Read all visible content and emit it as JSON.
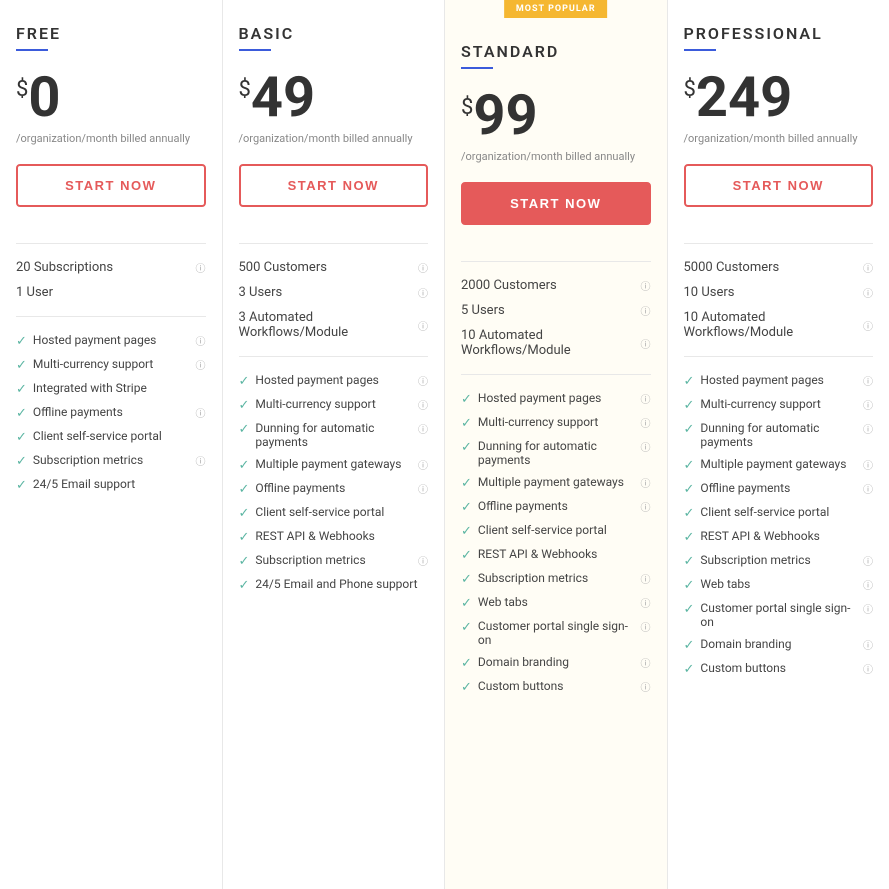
{
  "plans": [
    {
      "id": "free",
      "name": "FREE",
      "highlighted": false,
      "mostPopular": false,
      "price": "0",
      "period": "/organization/month billed annually",
      "cta": "START NOW",
      "ctaPrimary": false,
      "stats": [
        {
          "text": "20 Subscriptions",
          "hasInfo": true
        },
        {
          "text": "1 User",
          "hasInfo": false
        }
      ],
      "features": [
        {
          "text": "Hosted payment pages",
          "hasInfo": true
        },
        {
          "text": "Multi-currency support",
          "hasInfo": true
        },
        {
          "text": "Integrated with Stripe",
          "hasInfo": false
        },
        {
          "text": "Offline payments",
          "hasInfo": true
        },
        {
          "text": "Client self-service portal",
          "hasInfo": false
        },
        {
          "text": "Subscription metrics",
          "hasInfo": true
        },
        {
          "text": "24/5 Email support",
          "hasInfo": false
        }
      ]
    },
    {
      "id": "basic",
      "name": "BASIC",
      "highlighted": false,
      "mostPopular": false,
      "price": "49",
      "period": "/organization/month billed annually",
      "cta": "START NOW",
      "ctaPrimary": false,
      "stats": [
        {
          "text": "500 Customers",
          "hasInfo": true
        },
        {
          "text": "3 Users",
          "hasInfo": true
        },
        {
          "text": "3 Automated Workflows/Module",
          "hasInfo": true
        }
      ],
      "features": [
        {
          "text": "Hosted payment pages",
          "hasInfo": true
        },
        {
          "text": "Multi-currency support",
          "hasInfo": true
        },
        {
          "text": "Dunning for automatic payments",
          "hasInfo": true
        },
        {
          "text": "Multiple payment gateways",
          "hasInfo": true
        },
        {
          "text": "Offline payments",
          "hasInfo": true
        },
        {
          "text": "Client self-service portal",
          "hasInfo": false
        },
        {
          "text": "REST API & Webhooks",
          "hasInfo": false
        },
        {
          "text": "Subscription metrics",
          "hasInfo": true
        },
        {
          "text": "24/5 Email and Phone support",
          "hasInfo": false
        }
      ]
    },
    {
      "id": "standard",
      "name": "STANDARD",
      "highlighted": true,
      "mostPopular": true,
      "mostPopularLabel": "MOST POPULAR",
      "price": "99",
      "period": "/organization/month billed annually",
      "cta": "START NOW",
      "ctaPrimary": true,
      "stats": [
        {
          "text": "2000 Customers",
          "hasInfo": true
        },
        {
          "text": "5 Users",
          "hasInfo": true
        },
        {
          "text": "10 Automated Workflows/Module",
          "hasInfo": true
        }
      ],
      "features": [
        {
          "text": "Hosted payment pages",
          "hasInfo": true
        },
        {
          "text": "Multi-currency support",
          "hasInfo": true
        },
        {
          "text": "Dunning for automatic payments",
          "hasInfo": true
        },
        {
          "text": "Multiple payment gateways",
          "hasInfo": true
        },
        {
          "text": "Offline payments",
          "hasInfo": true
        },
        {
          "text": "Client self-service portal",
          "hasInfo": false
        },
        {
          "text": "REST API & Webhooks",
          "hasInfo": false
        },
        {
          "text": "Subscription metrics",
          "hasInfo": true
        },
        {
          "text": "Web tabs",
          "hasInfo": true
        },
        {
          "text": "Customer portal single sign-on",
          "hasInfo": true
        },
        {
          "text": "Domain branding",
          "hasInfo": true
        },
        {
          "text": "Custom buttons",
          "hasInfo": true
        }
      ]
    },
    {
      "id": "professional",
      "name": "PROFESSIONAL",
      "highlighted": false,
      "mostPopular": false,
      "price": "249",
      "period": "/organization/month billed annually",
      "cta": "START NOW",
      "ctaPrimary": false,
      "stats": [
        {
          "text": "5000 Customers",
          "hasInfo": true
        },
        {
          "text": "10 Users",
          "hasInfo": true
        },
        {
          "text": "10 Automated Workflows/Module",
          "hasInfo": true
        }
      ],
      "features": [
        {
          "text": "Hosted payment pages",
          "hasInfo": true
        },
        {
          "text": "Multi-currency support",
          "hasInfo": true
        },
        {
          "text": "Dunning for automatic payments",
          "hasInfo": true
        },
        {
          "text": "Multiple payment gateways",
          "hasInfo": true
        },
        {
          "text": "Offline payments",
          "hasInfo": true
        },
        {
          "text": "Client self-service portal",
          "hasInfo": false
        },
        {
          "text": "REST API & Webhooks",
          "hasInfo": false
        },
        {
          "text": "Subscription metrics",
          "hasInfo": true
        },
        {
          "text": "Web tabs",
          "hasInfo": true
        },
        {
          "text": "Customer portal single sign-on",
          "hasInfo": true
        },
        {
          "text": "Domain branding",
          "hasInfo": true
        },
        {
          "text": "Custom buttons",
          "hasInfo": true
        }
      ]
    }
  ]
}
